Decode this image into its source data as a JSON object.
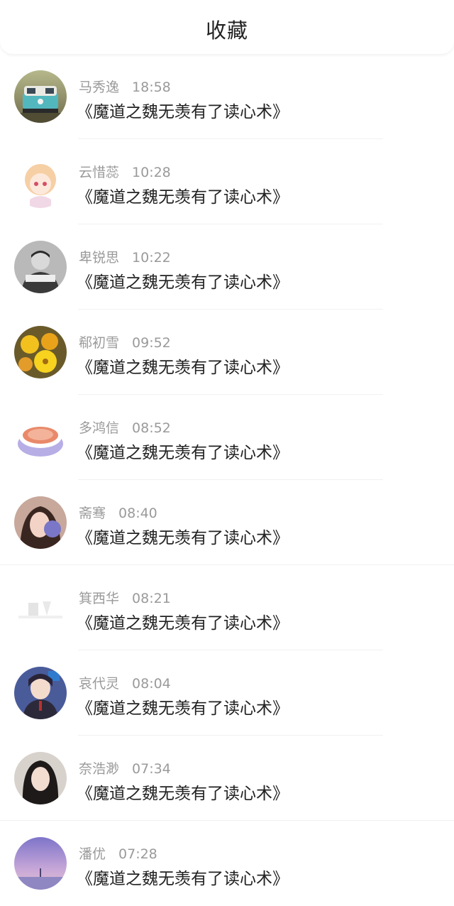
{
  "header": {
    "title": "收藏"
  },
  "items": [
    {
      "name": "马秀逸",
      "time": "18:58",
      "text": "《魔道之魏无羡有了读心术》",
      "avatar": "bus-avatar"
    },
    {
      "name": "云惜蕊",
      "time": "10:28",
      "text": "《魔道之魏无羡有了读心术》",
      "avatar": "anime-girl-avatar"
    },
    {
      "name": "卑锐思",
      "time": "10:22",
      "text": "《魔道之魏无羡有了读心术》",
      "avatar": "man-photo-avatar"
    },
    {
      "name": "郗初雪",
      "time": "09:52",
      "text": "《魔道之魏无羡有了读心术》",
      "avatar": "flowers-avatar"
    },
    {
      "name": "多鸿信",
      "time": "08:52",
      "text": "《魔道之魏无羡有了读心术》",
      "avatar": "cake-avatar"
    },
    {
      "name": "斋骞",
      "time": "08:40",
      "text": "《魔道之魏无羡有了读心术》",
      "avatar": "woman-portrait-avatar"
    },
    {
      "name": "箕西华",
      "time": "08:21",
      "text": "《魔道之魏无羡有了读心术》",
      "avatar": "faded-sketch-avatar"
    },
    {
      "name": "哀代灵",
      "time": "08:04",
      "text": "《魔道之魏无羡有了读心术》",
      "avatar": "anime-boy-avatar"
    },
    {
      "name": "奈浩渺",
      "time": "07:34",
      "text": "《魔道之魏无羡有了读心术》",
      "avatar": "woman-long-hair-avatar"
    },
    {
      "name": "潘优",
      "time": "07:28",
      "text": "《魔道之魏无羡有了读心术》",
      "avatar": "sunset-sky-avatar"
    }
  ]
}
